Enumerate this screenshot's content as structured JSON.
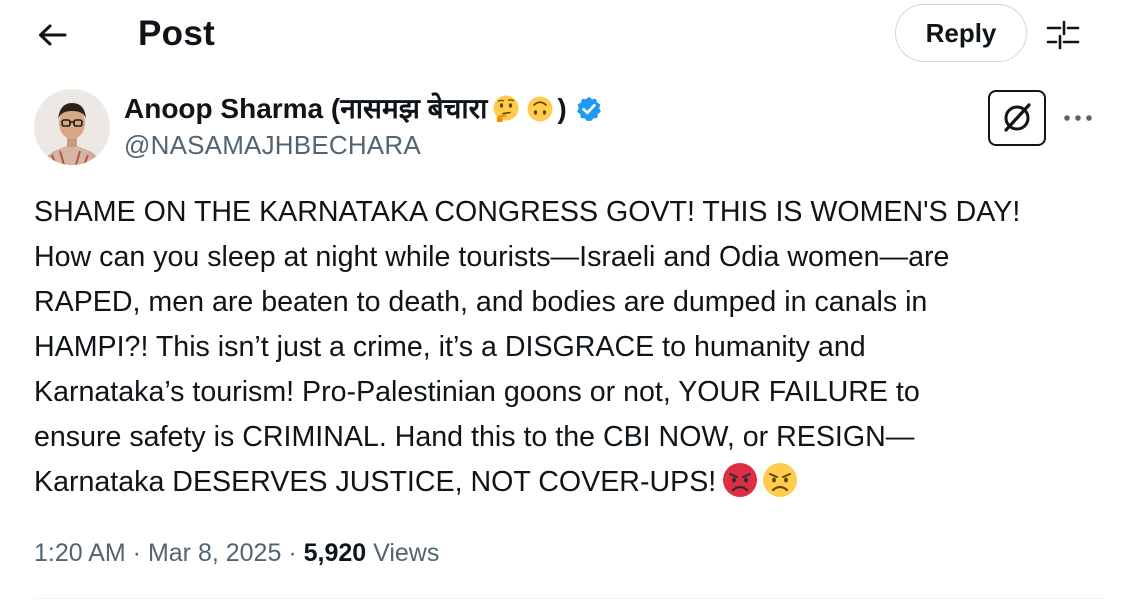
{
  "header": {
    "title": "Post",
    "reply_label": "Reply"
  },
  "author": {
    "name": "Anoop Sharma (नासमझ बेचारा",
    "name_close": ")",
    "name_emojis": [
      "thinking-face",
      "upside-down-face"
    ],
    "verified": true,
    "handle": "@NASAMAJHBECHARA"
  },
  "tweet": {
    "lines": [
      "SHAME ON THE KARNATAKA CONGRESS GOVT! THIS IS WOMEN'S DAY!",
      "How can you sleep at night while tourists—Israeli and Odia women—are",
      "RAPED, men are beaten to death, and bodies are dumped in canals in",
      "HAMPI?! This isn’t just a crime, it’s a DISGRACE to humanity and",
      "Karnataka’s tourism! Pro-Palestinian goons or not, YOUR FAILURE to",
      "ensure safety is CRIMINAL. Hand this to the CBI NOW, or RESIGN—",
      "Karnataka DESERVES JUSTICE, NOT COVER-UPS!"
    ],
    "end_emojis": [
      "pouting-face",
      "angry-face"
    ]
  },
  "meta": {
    "time": "1:20 AM",
    "separator": " · ",
    "date": "Mar 8, 2025",
    "views_count": "5,920",
    "views_label": "Views"
  },
  "icons": {
    "back": "arrow-left-icon",
    "settings": "sliders-icon",
    "grok": "grok-icon",
    "more": "more-dots-icon",
    "verified": "verified-badge-icon"
  },
  "colors": {
    "text_primary": "#0f1419",
    "text_secondary": "#536471",
    "verified_blue": "#1d9bf0",
    "border": "#cfd9de"
  }
}
